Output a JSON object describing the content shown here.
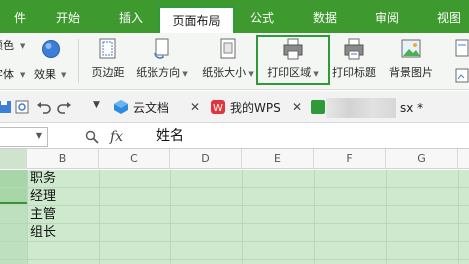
{
  "menu": {
    "tabs": [
      "开始",
      "插入",
      "页面布局",
      "公式",
      "数据",
      "审阅",
      "视图"
    ],
    "active": "页面布局"
  },
  "ribbon": {
    "left_partial": [
      "颜色",
      "字体"
    ],
    "theme_effects": "效果",
    "buttons": [
      "页边距",
      "纸张方向",
      "纸张大小",
      "打印区域",
      "打印标题",
      "背景图片"
    ]
  },
  "quickbar": {
    "tabs": [
      "云文档",
      "我的WPS"
    ],
    "current_doc_suffix": "sx *"
  },
  "formula": {
    "fx": "fx",
    "value": "姓名"
  },
  "grid": {
    "columns": [
      "B",
      "C",
      "D",
      "E",
      "F",
      "G"
    ],
    "cells": [
      "职务",
      "经理",
      "主管",
      "组长"
    ]
  },
  "colors": {
    "menu_bg": "#3e9a2f",
    "highlight": "#2f9a3a",
    "selection": "#cfe9cf"
  }
}
